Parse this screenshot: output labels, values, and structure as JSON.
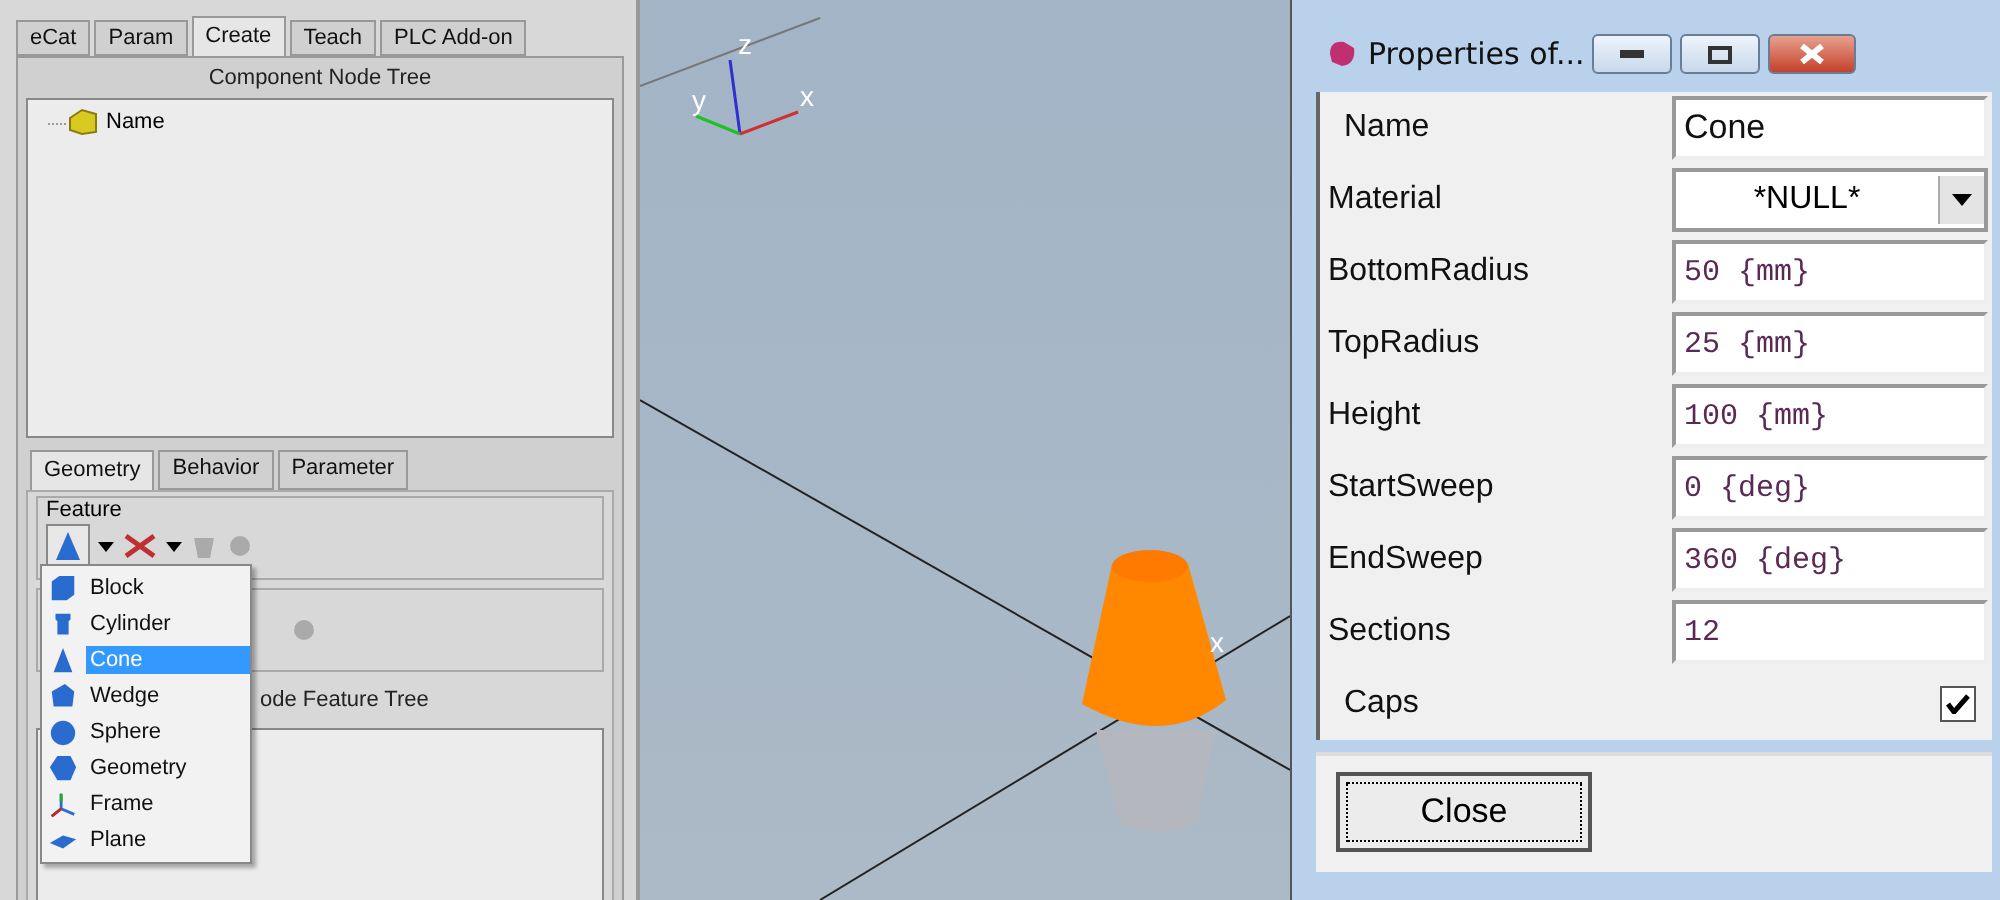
{
  "left_panel": {
    "tabs": [
      {
        "label": "eCat",
        "selected": false
      },
      {
        "label": "Param",
        "selected": false
      },
      {
        "label": "Create",
        "selected": true
      },
      {
        "label": "Teach",
        "selected": false
      },
      {
        "label": "PLC Add-on",
        "selected": false
      }
    ],
    "node_tree": {
      "title": "Component Node Tree",
      "items": [
        {
          "label": "Name"
        }
      ]
    },
    "sub_tabs": [
      {
        "label": "Geometry",
        "selected": true
      },
      {
        "label": "Behavior",
        "selected": false
      },
      {
        "label": "Parameter",
        "selected": false
      }
    ],
    "feature_group": {
      "title": "Feature"
    },
    "feature_tree": {
      "title": "ode Feature Tree"
    },
    "feature_menu": [
      {
        "label": "Block",
        "selected": false
      },
      {
        "label": "Cylinder",
        "selected": false
      },
      {
        "label": "Cone",
        "selected": true
      },
      {
        "label": "Wedge",
        "selected": false
      },
      {
        "label": "Sphere",
        "selected": false
      },
      {
        "label": "Geometry",
        "selected": false
      },
      {
        "label": "Frame",
        "selected": false
      },
      {
        "label": "Plane",
        "selected": false
      }
    ]
  },
  "viewport": {
    "axis_labels": [
      "z",
      "y",
      "x"
    ],
    "object_label": "x"
  },
  "properties_window": {
    "title": "Properties of...",
    "rows": [
      {
        "kind": "text",
        "label": "Name",
        "value": "Cone"
      },
      {
        "kind": "select",
        "label": "Material",
        "value": "*NULL*"
      },
      {
        "kind": "text",
        "label": "BottomRadius",
        "value": "50 {mm}"
      },
      {
        "kind": "text",
        "label": "TopRadius",
        "value": "25 {mm}"
      },
      {
        "kind": "text",
        "label": "Height",
        "value": "100 {mm}"
      },
      {
        "kind": "text",
        "label": "StartSweep",
        "value": "0 {deg}"
      },
      {
        "kind": "text",
        "label": "EndSweep",
        "value": "360 {deg}"
      },
      {
        "kind": "text",
        "label": "Sections",
        "value": "12"
      },
      {
        "kind": "checkbox",
        "label": "Caps",
        "checked": true
      }
    ],
    "close_button": "Close"
  }
}
